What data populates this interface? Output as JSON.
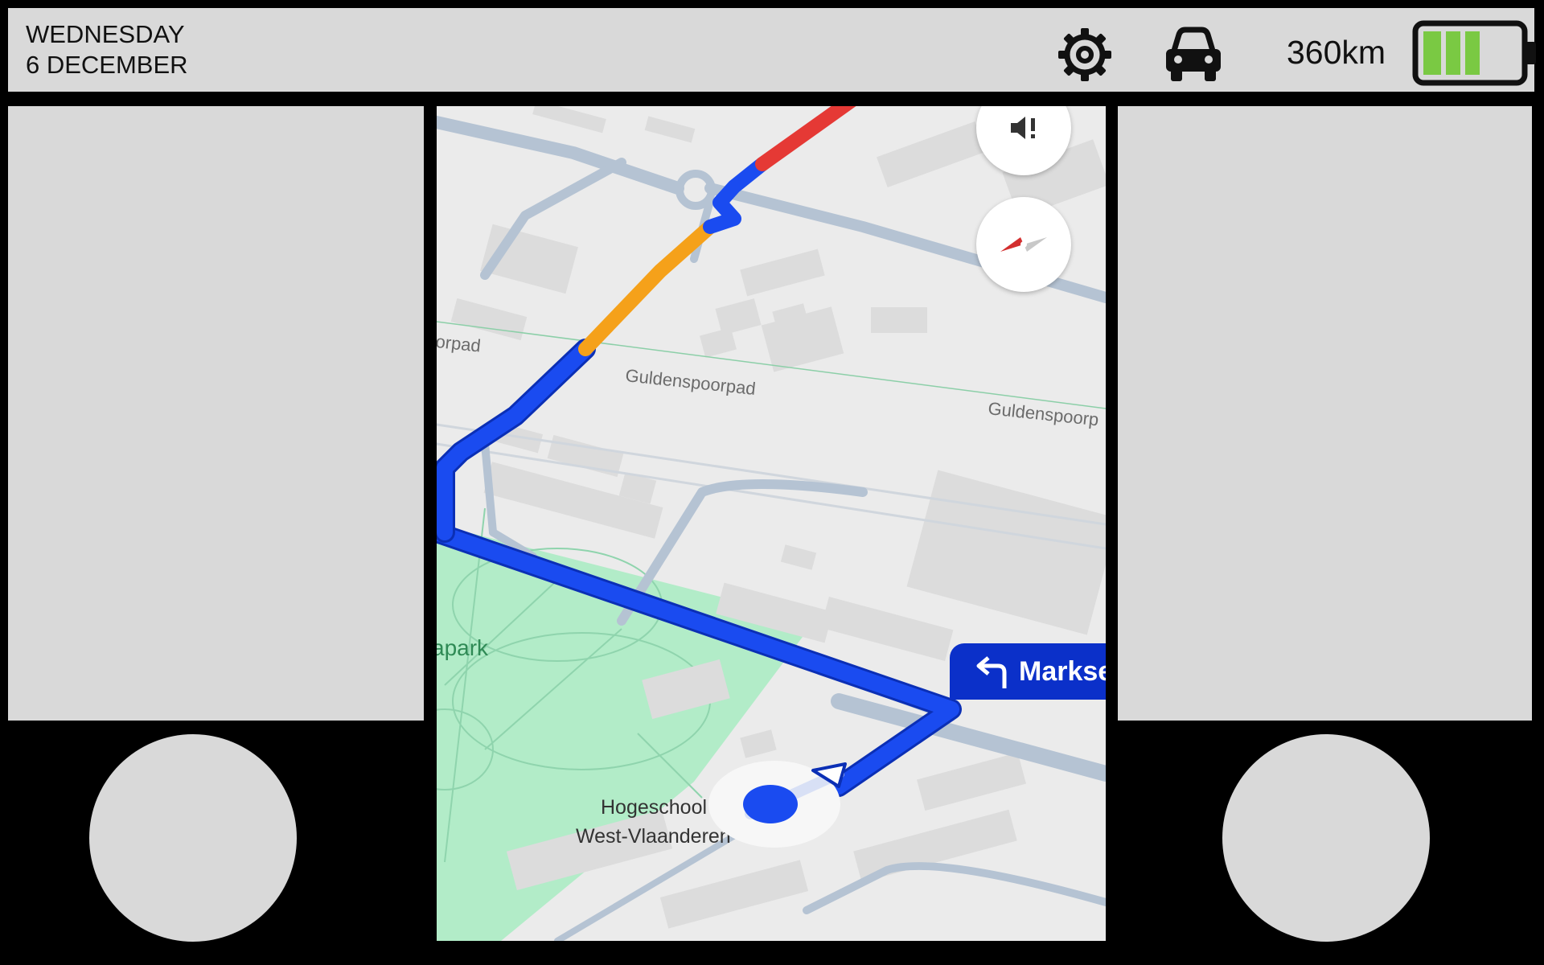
{
  "header": {
    "day": "WEDNESDAY",
    "date": "6 DECEMBER",
    "range": "360km",
    "icons": {
      "settings": "gear-icon",
      "vehicle": "car-icon",
      "battery": "battery-icon"
    },
    "battery_level": 0.6,
    "battery_color": "#7ac943"
  },
  "map": {
    "labels": {
      "path_partial": "orpad",
      "path_main": "Guldenspoorpad",
      "path_right": "Guldenspoorp",
      "park_partial": "apark",
      "poi_line1": "Hogeschool",
      "poi_line2": "West-Vlaanderen"
    },
    "turn_instruction": {
      "street": "Markse",
      "icon": "turn-left-icon"
    },
    "buttons": {
      "mute": "volume-alert-icon",
      "compass": "compass-icon"
    },
    "colors": {
      "route": "#1a4bf0",
      "traffic_slow": "#f5a11a",
      "traffic_heavy": "#e53935",
      "park": "#b2ecc8",
      "road": "#b5c3d3"
    }
  }
}
